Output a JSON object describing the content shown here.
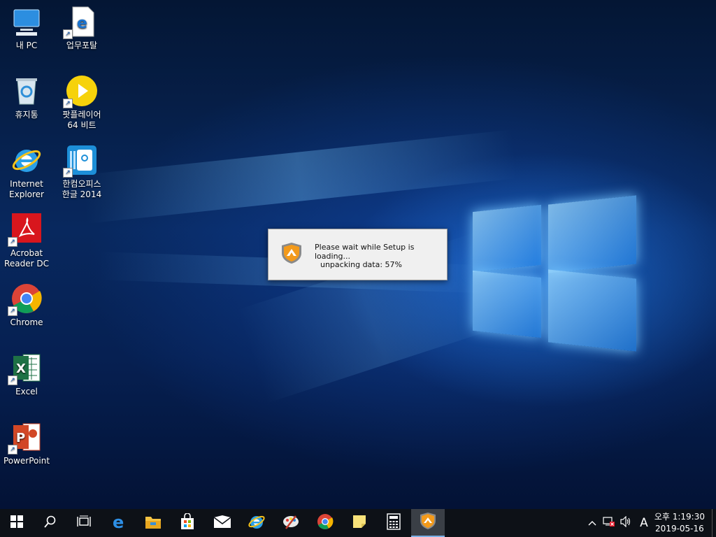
{
  "desktop": {
    "icons": [
      {
        "label": "내 PC",
        "icon": "computer-icon"
      },
      {
        "label": "업무포탈",
        "icon": "edge-document-icon"
      },
      {
        "label": "휴지통",
        "icon": "recycle-bin-icon"
      },
      {
        "label_line1": "팟플레이어",
        "label_line2": "64 비트",
        "icon": "potplayer-icon"
      },
      {
        "label_line1": "Internet",
        "label_line2": "Explorer",
        "icon": "internet-explorer-icon"
      },
      {
        "label_line1": "한컴오피스",
        "label_line2": "한글 2014",
        "icon": "hwp-icon"
      },
      {
        "label_line1": "Acrobat",
        "label_line2": "Reader DC",
        "icon": "acrobat-icon"
      },
      {
        "label": "Chrome",
        "icon": "chrome-icon"
      },
      {
        "label": "Excel",
        "icon": "excel-icon"
      },
      {
        "label": "PowerPoint",
        "icon": "powerpoint-icon"
      }
    ]
  },
  "dialog": {
    "message": "Please wait while Setup is loading...",
    "status": "unpacking data: 57%",
    "progress_percent": 57,
    "icon": "setup-shield-icon"
  },
  "taskbar": {
    "items": [
      "start-icon",
      "search-icon",
      "task-view-icon",
      "edge-icon",
      "file-explorer-icon",
      "store-icon",
      "mail-icon",
      "internet-explorer-icon",
      "paint-icon",
      "chrome-icon",
      "sticky-notes-icon",
      "calculator-icon",
      "setup-shield-icon"
    ],
    "tray": {
      "input_indicator": "A",
      "time": "오후 1:19:30",
      "date": "2019-05-16"
    }
  },
  "colors": {
    "taskbar_bg": "#0d1117",
    "active_accent": "#7ab0e6",
    "wallpaper_blue": "#0a4aa8"
  }
}
